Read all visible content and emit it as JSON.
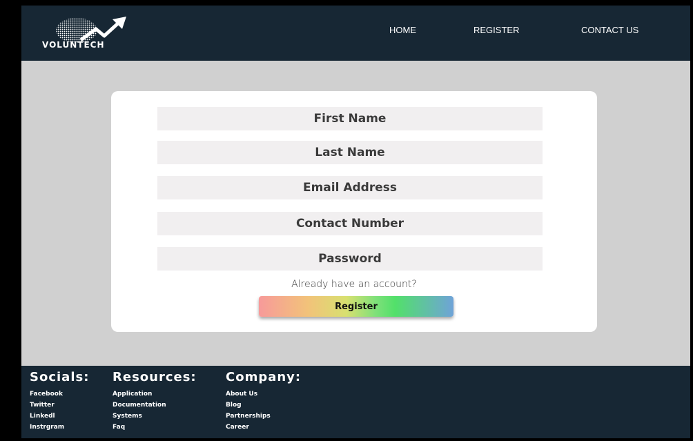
{
  "brand": {
    "name": "VOLUNTECH",
    "colors": {
      "header_bg": "#172734",
      "page_bg": "#d0d0d0",
      "field_bg": "#f1eff0"
    }
  },
  "nav": {
    "home": "HOME",
    "register": "REGISTER",
    "contact": "CONTACT US"
  },
  "form": {
    "first_name": "First Name",
    "last_name": "Last Name",
    "email": "Email Address",
    "contact": "Contact Number",
    "password": "Password",
    "already": "Already have an account?",
    "submit": "Register"
  },
  "footer": {
    "socials": {
      "title": "Socials:",
      "items": [
        "Facebook",
        "Twitter",
        "Linkedl",
        "Instrgram"
      ]
    },
    "resources": {
      "title": "Resources:",
      "items": [
        "Application",
        "Documentation",
        "Systems",
        "Faq"
      ]
    },
    "company": {
      "title": "Company:",
      "items": [
        "About Us",
        "Blog",
        "Partnerships",
        "Career"
      ]
    }
  }
}
